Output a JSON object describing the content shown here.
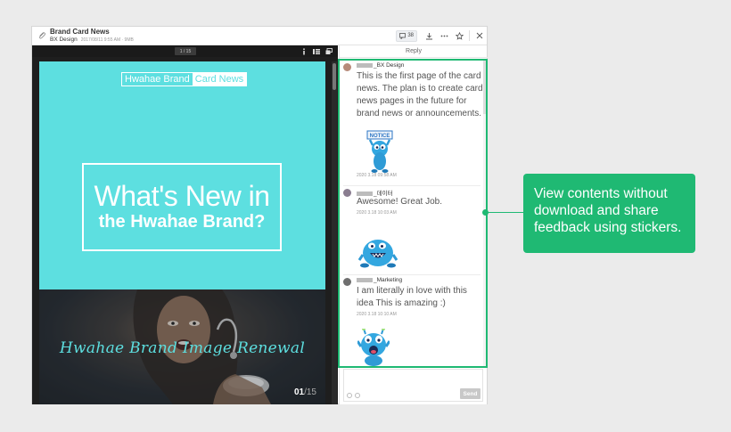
{
  "window": {
    "title": "Brand Card News",
    "owner": "BX Design",
    "meta": "2017/08/11 9:55 AM · 9MB",
    "comment_count": "38"
  },
  "viewer": {
    "page_indicator": "1 / 15",
    "slide1": {
      "brand_part1": "Hwahae Brand",
      "brand_part2": "Card News",
      "headline_1": "What's New in",
      "headline_2": "the Hwahae Brand?"
    },
    "slide2": {
      "title": "Hwahae Brand Image Renewal",
      "page_current": "01",
      "page_total": "/15"
    }
  },
  "panel": {
    "tab_label": "Reply",
    "comments": [
      {
        "author": "_BX Design",
        "text": "This is the first page of the card news. The plan is to create card news pages in the future for brand news or announcements.",
        "sticker_label": "NOTICE",
        "time": "2020 3.18 09:58 AM"
      },
      {
        "author": "_데이터",
        "text": "Awesome! Great Job.",
        "time": "2020 3.18 10:03 AM"
      },
      {
        "author": "_Marketing",
        "text": "I am literally in love with this idea This is amazing :)",
        "time": "2020 3.18 10:10 AM"
      }
    ],
    "send_label": "Send"
  },
  "callout": {
    "line1": "View contents without",
    "line2": "download and share",
    "line3": "feedback using stickers."
  },
  "colors": {
    "accent_green": "#1fb973",
    "slide_teal": "#5ddfe0"
  }
}
